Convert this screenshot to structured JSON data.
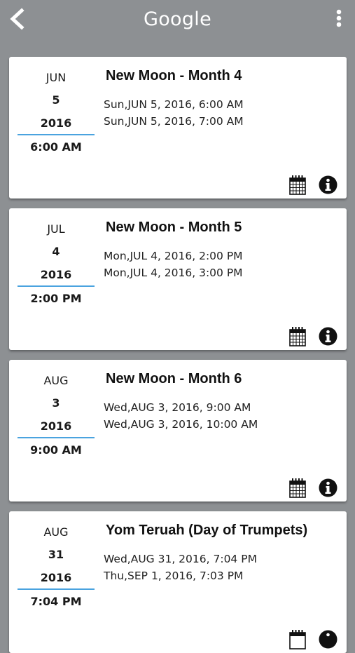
{
  "header": {
    "title": "Google"
  },
  "events": [
    {
      "month": "JUN",
      "day": "5",
      "year": "2016",
      "time": "6:00 AM",
      "title": "New Moon - Month 4",
      "start": "Sun,JUN 5, 2016, 6:00 AM",
      "end": "Sun,JUN 5, 2016, 7:00 AM"
    },
    {
      "month": "JUL",
      "day": "4",
      "year": "2016",
      "time": "2:00 PM",
      "title": "New Moon - Month 5",
      "start": "Mon,JUL 4, 2016, 2:00 PM",
      "end": "Mon,JUL 4, 2016, 3:00 PM"
    },
    {
      "month": "AUG",
      "day": "3",
      "year": "2016",
      "time": "9:00 AM",
      "title": "New Moon - Month 6",
      "start": "Wed,AUG 3, 2016, 9:00 AM",
      "end": "Wed,AUG 3, 2016, 10:00 AM"
    },
    {
      "month": "AUG",
      "day": "31",
      "year": "2016",
      "time": "7:04 PM",
      "title": "Yom Teruah (Day of Trumpets)",
      "start": "Wed,AUG 31, 2016, 7:04 PM",
      "end": "Thu,SEP 1, 2016, 7:03 PM"
    }
  ],
  "icons": {
    "back": "chevron-left-icon",
    "menu": "more-vertical-icon",
    "calendar": "calendar-icon",
    "info": "info-icon"
  },
  "colors": {
    "background": "#8d9093",
    "card": "#ffffff",
    "accent_rule": "#4aa3df"
  }
}
